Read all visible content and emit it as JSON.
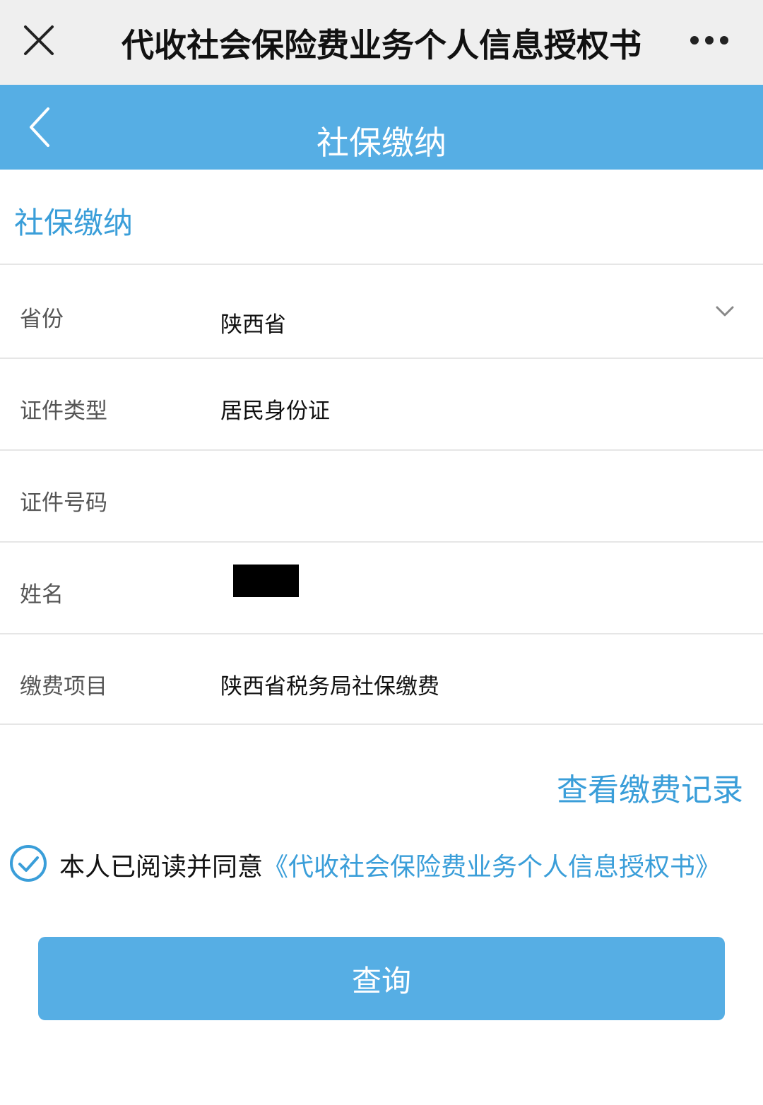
{
  "window": {
    "title": "代收社会保险费业务个人信息授权书",
    "close_icon": "close-icon",
    "more_icon": "more-icon"
  },
  "navbar": {
    "title": "社保缴纳",
    "back_icon": "chevron-left-icon",
    "color": "#56aee4"
  },
  "section": {
    "title": "社保缴纳"
  },
  "form": {
    "province": {
      "label": "省份",
      "value": "陕西省"
    },
    "id_type": {
      "label": "证件类型",
      "value": "居民身份证"
    },
    "id_number": {
      "label": "证件号码",
      "value": ""
    },
    "name": {
      "label": "姓名",
      "value": ""
    },
    "fee_item": {
      "label": "缴费项目",
      "value": "陕西省税务局社保缴费"
    }
  },
  "records_link": "查看缴费记录",
  "agreement": {
    "checked": true,
    "text": "本人已阅读并同意",
    "link": "《代收社会保险费业务个人信息授权书》"
  },
  "query_button": "查询",
  "colors": {
    "accent": "#56aee4",
    "link": "#3a9ed9"
  }
}
